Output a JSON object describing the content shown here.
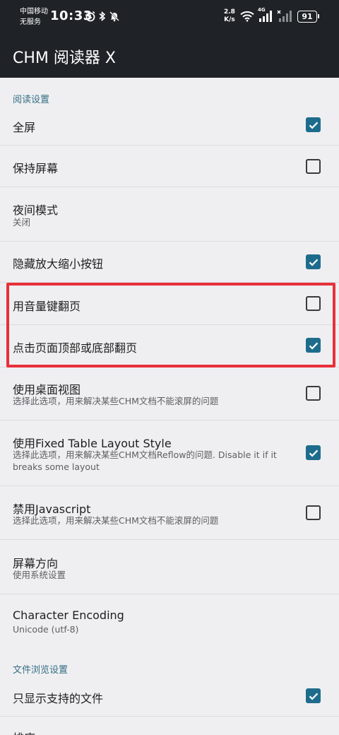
{
  "status_bar": {
    "carrier_line1": "中国移动",
    "carrier_line2": "无服务",
    "time": "10:33",
    "net_speed_value": "2.8",
    "net_speed_unit": "K/s",
    "network_type": "4G",
    "battery": "91",
    "icons": [
      "alarm-icon",
      "bluetooth-icon",
      "mute-icon",
      "wifi-icon",
      "signal-icon",
      "signal-no-service-icon",
      "battery-icon"
    ]
  },
  "app_bar": {
    "title": "CHM 阅读器 X"
  },
  "sections": {
    "reading": "阅读设置",
    "file_browsing": "文件浏览设置"
  },
  "settings": {
    "fullscreen": {
      "title": "全屏",
      "checked": true
    },
    "keep_screen": {
      "title": "保持屏幕",
      "checked": false
    },
    "night_mode": {
      "title": "夜间模式",
      "summary": "关闭"
    },
    "hide_zoom": {
      "title": "隐藏放大缩小按钮",
      "checked": true
    },
    "volume_page": {
      "title": "用音量键翻页",
      "checked": false
    },
    "tap_page": {
      "title": "点击页面顶部或底部翻页",
      "checked": true
    },
    "desktop_view": {
      "title": "使用桌面视图",
      "summary": "选择此选项，用来解决某些CHM文档不能滚屏的问题",
      "checked": false
    },
    "fixed_table": {
      "title": "使用Fixed Table Layout Style",
      "summary": "选择此选项，用来解决某些CHM文档Reflow的问题. Disable it if it breaks some layout",
      "checked": true
    },
    "disable_js": {
      "title": "禁用Javascript",
      "summary": "选择此选项，用来解决某些CHM文档不能滚屏的问题",
      "checked": false
    },
    "orientation": {
      "title": "屏幕方向",
      "summary": "使用系统设置"
    },
    "encoding": {
      "title": "Character Encoding",
      "summary": "Unicode (utf-8)"
    },
    "supported_only": {
      "title": "只显示支持的文件",
      "checked": true
    },
    "sort": {
      "title": "排序"
    }
  },
  "colors": {
    "accent": "#1e6c8c",
    "section_header": "#356f86",
    "app_bar": "#1f2327",
    "highlight_box": "#e8303a"
  }
}
